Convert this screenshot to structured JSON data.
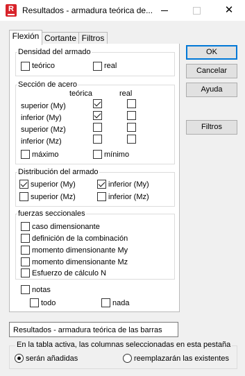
{
  "window": {
    "title": "Resultados - armadura teórica de...",
    "app_icon_letter": "R",
    "minimize_glyph": "—",
    "maximize_glyph": "☐",
    "close_glyph": "✕"
  },
  "tabs": [
    {
      "label": "Flexión",
      "active": true
    },
    {
      "label": "Cortante",
      "active": false
    },
    {
      "label": "Filtros",
      "active": false
    }
  ],
  "densidad": {
    "title": "Densidad del armado",
    "teorico": {
      "label": "teórico",
      "checked": false
    },
    "real": {
      "label": "real",
      "checked": false
    }
  },
  "seccion": {
    "title": "Sección de acero",
    "col_teorica": "teórica",
    "col_real": "real",
    "rows": [
      {
        "label": "superior (My)",
        "teorica": true,
        "real": false
      },
      {
        "label": "inferior (My)",
        "teorica": true,
        "real": false
      },
      {
        "label": "superior (Mz)",
        "teorica": false,
        "real": false
      },
      {
        "label": "inferior (Mz)",
        "teorica": false,
        "real": false
      }
    ],
    "maximo": {
      "label": "máximo",
      "checked": false
    },
    "minimo": {
      "label": "mínimo",
      "checked": false
    }
  },
  "distribucion": {
    "title": "Distribución del armado",
    "superior_my": {
      "label": "superior (My)",
      "checked": true
    },
    "inferior_my": {
      "label": "inferior (My)",
      "checked": true
    },
    "superior_mz": {
      "label": "superior (Mz)",
      "checked": false
    },
    "inferior_mz": {
      "label": "inferior (Mz)",
      "checked": false
    }
  },
  "fuerzas": {
    "title": "fuerzas seccionales",
    "items": [
      {
        "label": "caso dimensionante",
        "checked": false
      },
      {
        "label": "definición de la combinación",
        "checked": false
      },
      {
        "label": "momento dimensionante My",
        "checked": false
      },
      {
        "label": "momento dimensionante Mz",
        "checked": false
      },
      {
        "label": "Esfuerzo de cálculo N",
        "checked": false
      }
    ]
  },
  "notas": {
    "label": "notas",
    "checked": false,
    "todo": {
      "label": "todo",
      "checked": false
    },
    "nada": {
      "label": "nada",
      "checked": false
    }
  },
  "buttons": {
    "ok": "OK",
    "cancelar": "Cancelar",
    "ayuda": "Ayuda",
    "filtros": "Filtros"
  },
  "result_name": "Resultados - armadura teórica de las barras",
  "columns_group": {
    "title": "En la tabla activa, las columnas seleccionadas en esta pestaña",
    "option_add": {
      "label": "serán añadidas",
      "selected": true
    },
    "option_replace": {
      "label": "reemplazarán las existentes",
      "selected": false
    }
  },
  "colors": {
    "accent": "#0078d7",
    "app_icon": "#d8232a"
  }
}
